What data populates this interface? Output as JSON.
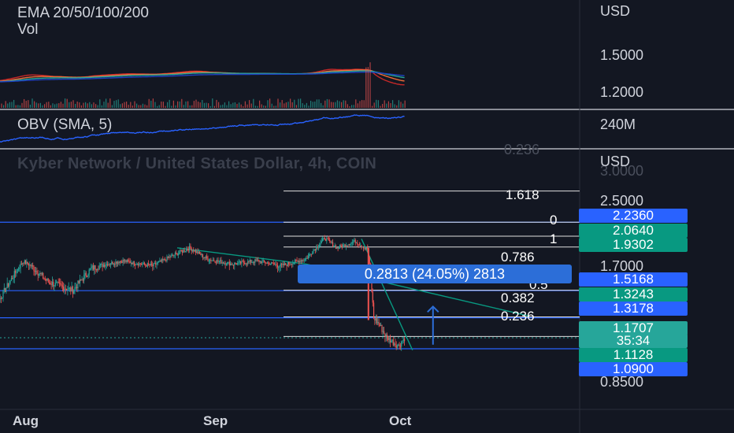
{
  "panes": {
    "ema_label": "EMA 20/50/100/200",
    "vol_label": "Vol",
    "obv_label": "OBV (SMA, 5)",
    "ghost_title": "Kyber Network / United States Dollar, 4h, COIN",
    "ghost_top": "0.236",
    "ghost_scale": "3.0000"
  },
  "price_axis": {
    "top_currency": "USD",
    "top_ticks": [
      "1.5000",
      "1.2000"
    ],
    "obv_tick": "240M",
    "main_currency": "USD",
    "main_ticks": [
      "2.5000",
      "1.7000",
      "0.8500"
    ]
  },
  "price_tags": [
    {
      "text": "2.2360",
      "color": "#2962ff"
    },
    {
      "text": "2.0640",
      "color": "#089981"
    },
    {
      "text": "1.9302",
      "color": "#089981"
    },
    {
      "text": "1.5168",
      "color": "#2962ff"
    },
    {
      "text": "1.3243",
      "color": "#089981"
    },
    {
      "text": "1.3178",
      "color": "#2962ff"
    },
    {
      "text": "1.1707",
      "color": "#26a69a"
    },
    {
      "text": "35:34",
      "color": "#26a69a"
    },
    {
      "text": "1.1128",
      "color": "#089981"
    },
    {
      "text": "1.0900",
      "color": "#2962ff"
    }
  ],
  "fib_levels": [
    "1.618",
    "0",
    "1",
    "0.786",
    "0.5",
    "0.382",
    "0.236"
  ],
  "measure_text": "0.2813 (24.05%) 2813",
  "time_axis": [
    "Aug",
    "Sep",
    "Oct"
  ],
  "colors": {
    "background": "#131722",
    "up": "#26a69a",
    "down": "#ef5350",
    "horizontal_line": "#2962ff",
    "trendline": "#089981",
    "obv": "#2962ff",
    "ema20": "#c62828",
    "ema50": "#ef6c3a",
    "ema100": "#26a69a",
    "ema200": "#1e3fbf"
  },
  "chart_data": {
    "type": "candlestick",
    "title": "Kyber Network / United States Dollar, 4h, COIN",
    "x_ticks": [
      "Aug",
      "Sep",
      "Oct"
    ],
    "y_ticks": [
      "2.5000",
      "1.7000",
      "0.8500"
    ],
    "close_path": [
      {
        "t": "Jul 25",
        "price": 1.32
      },
      {
        "t": "Jul 28",
        "price": 1.45
      },
      {
        "t": "Aug 1",
        "price": 1.75
      },
      {
        "t": "Aug 5",
        "price": 1.58
      },
      {
        "t": "Aug 9",
        "price": 1.52
      },
      {
        "t": "Aug 12",
        "price": 1.68
      },
      {
        "t": "Aug 17",
        "price": 1.76
      },
      {
        "t": "Aug 22",
        "price": 1.7
      },
      {
        "t": "Aug 26",
        "price": 1.85
      },
      {
        "t": "Aug 28",
        "price": 1.92
      },
      {
        "t": "Aug 31",
        "price": 1.78
      },
      {
        "t": "Sep 4",
        "price": 1.72
      },
      {
        "t": "Sep 8",
        "price": 1.76
      },
      {
        "t": "Sep 12",
        "price": 1.7
      },
      {
        "t": "Sep 16",
        "price": 1.79
      },
      {
        "t": "Sep 19",
        "price": 2.04
      },
      {
        "t": "Sep 21",
        "price": 1.92
      },
      {
        "t": "Sep 24",
        "price": 2.0
      },
      {
        "t": "Sep 26",
        "price": 1.9
      },
      {
        "t": "Sep 27",
        "price": 1.32
      },
      {
        "t": "Sep 28",
        "price": 1.26
      },
      {
        "t": "Sep 29",
        "price": 1.18
      },
      {
        "t": "Oct 1",
        "price": 1.11
      },
      {
        "t": "Oct 2",
        "price": 1.17
      }
    ],
    "horizontal_lines": [
      2.236,
      1.5168,
      1.3178,
      1.09
    ],
    "fibonacci": [
      {
        "level": "1.618",
        "price": 2.62
      },
      {
        "level": "0",
        "price": 2.236
      },
      {
        "level": "1",
        "price": 2.064
      },
      {
        "level": "0.786",
        "price": 1.9302
      },
      {
        "level": "0.5",
        "price": 1.52
      },
      {
        "level": "0.382",
        "price": 1.3243
      },
      {
        "level": "0.236",
        "price": 1.18
      }
    ],
    "measurement": {
      "from": 1.1128,
      "to": 1.3941,
      "change": 0.2813,
      "percent": 24.05
    },
    "last_price": 1.1707,
    "countdown": "35:34"
  }
}
